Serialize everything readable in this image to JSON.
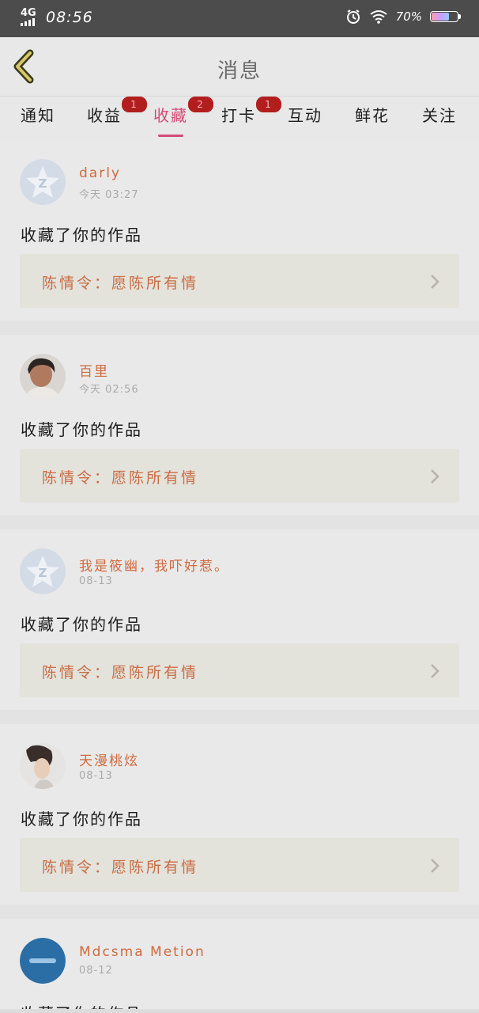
{
  "status": {
    "network": "4G",
    "time": "08:56",
    "battery": "70%",
    "icons": [
      "alarm-icon",
      "wifi-icon",
      "battery-icon"
    ]
  },
  "header": {
    "title": "消息",
    "back_icon": "chevron-left-icon"
  },
  "tabs": [
    {
      "label": "通知",
      "badge": ""
    },
    {
      "label": "收益",
      "badge": "1"
    },
    {
      "label": "收藏",
      "badge": "2",
      "active": true
    },
    {
      "label": "打卡",
      "badge": "1"
    },
    {
      "label": "互动",
      "badge": ""
    },
    {
      "label": "鲜花",
      "badge": ""
    },
    {
      "label": "关注",
      "badge": ""
    }
  ],
  "items": [
    {
      "name": "darly",
      "time": "今天 03:27",
      "action": "收藏了你的作品",
      "work": "陈情令：愿陈所有情",
      "avatar": "default-star-avatar"
    },
    {
      "name": "百里",
      "time": "今天 02:56",
      "action": "收藏了你的作品",
      "work": "陈情令：愿陈所有情",
      "avatar": "user-photo-avatar"
    },
    {
      "name": "我是筱幽，我吓好惹。",
      "time": "08-13",
      "action": "收藏了你的作品",
      "work": "陈情令：愿陈所有情",
      "avatar": "default-star-avatar"
    },
    {
      "name": "天漫桃炫",
      "time": "08-13",
      "action": "收藏了你的作品",
      "work": "陈情令：愿陈所有情",
      "avatar": "user-photo-avatar"
    },
    {
      "name": "Mdcsma Metion",
      "time": "08-12",
      "action": "收藏了你的作品",
      "work": "",
      "avatar": "blue-circle-avatar"
    }
  ],
  "colors": {
    "accent": "#d24b76",
    "badge": "#b21e1e",
    "name": "#cf6a3e",
    "work_bg": "#e3e2db"
  }
}
